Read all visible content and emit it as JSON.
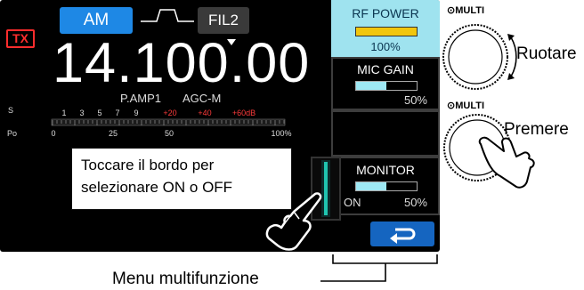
{
  "screen": {
    "tx_badge": "TX",
    "mode_button": "AM",
    "filter_button": "FIL2",
    "frequency": "14.100.00",
    "preamp": "P.AMP1",
    "agc": "AGC-M",
    "s_meter_label": "S",
    "s_meter_scale": [
      "1",
      "3",
      "5",
      "7",
      "9",
      "+20",
      "+40",
      "+60dB"
    ],
    "po_meter_label": "Po",
    "po_meter_scale": [
      "0",
      "25",
      "50",
      "100%"
    ]
  },
  "callout": {
    "line1": "Toccare il bordo per",
    "line2": "selezionare ON o OFF"
  },
  "multi_menu": {
    "rf_power": {
      "label": "RF POWER",
      "value": "100%",
      "level": 1.0
    },
    "mic_gain": {
      "label": "MIC GAIN",
      "value": "50%",
      "level": 0.5
    },
    "monitor": {
      "label": "MONITOR",
      "state": "ON",
      "value": "50%",
      "level": 0.5
    },
    "back_icon": "return-arrow-icon"
  },
  "annotations": {
    "multi_label_1": "MULTI",
    "rotate_text": "Ruotare",
    "multi_label_2": "MULTI",
    "press_text": "Premere",
    "menu_caption": "Menu multifunzione"
  },
  "colors": {
    "tx": "#ff2d2d",
    "mode_button": "#1e88e5",
    "rf_power_tile": "#9fe3ef",
    "rf_power_bar": "#f2c60c",
    "gain_bar": "#9ee8f4",
    "red_scale": "#ff3b3b"
  }
}
